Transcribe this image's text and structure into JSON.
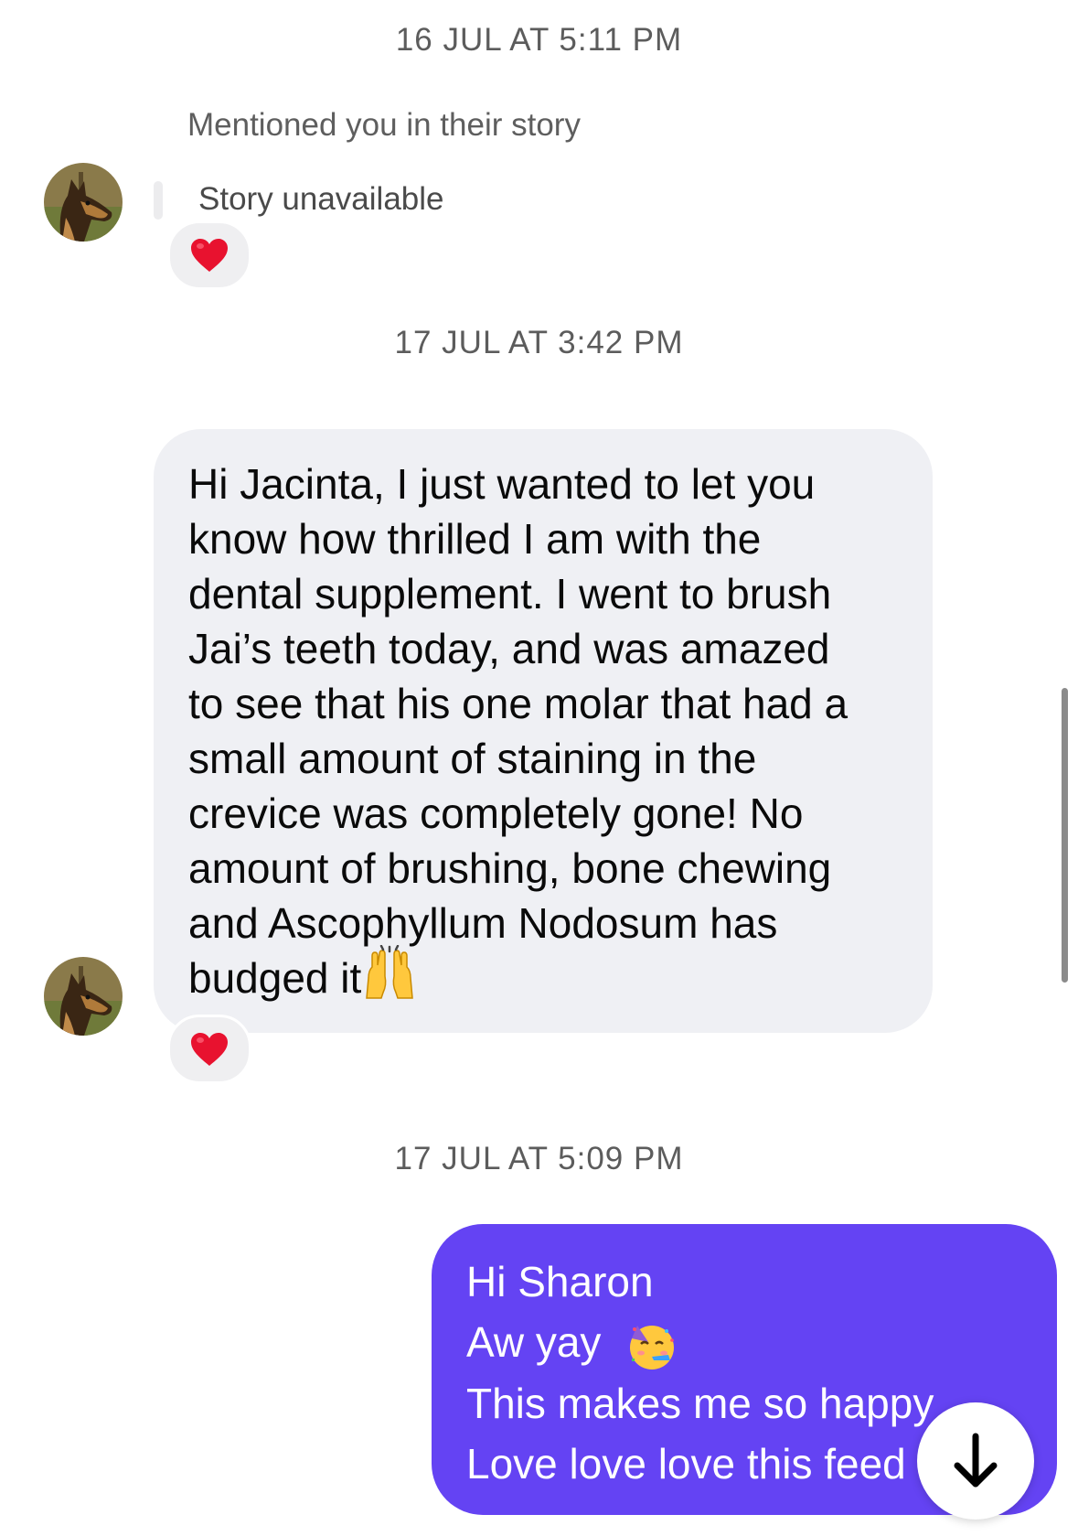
{
  "thread": {
    "timestamps": [
      "16 JUL AT 5:11 PM",
      "17 JUL AT 3:42 PM",
      "17 JUL AT 5:09 PM"
    ],
    "story": {
      "mention_text": "Mentioned you in their story",
      "status_text": "Story unavailable",
      "reaction": "red-heart"
    },
    "incoming_message": {
      "text": "Hi Jacinta, I just wanted to let you\nknow how thrilled I am with the\ndental supplement. I went to brush\nJai’s teeth today, and was amazed\nto see that his one molar that had a\nsmall amount of staining in the\ncrevice was completely gone! No\namount of brushing, bone chewing\nand Ascophyllum Nodosum has\nbudged it",
      "trailing_emoji": "raising-hands",
      "reaction": "red-heart"
    },
    "outgoing_message": {
      "lines": [
        "Hi Sharon",
        "Aw yay",
        "This makes me so happy",
        "Love love love this feed"
      ],
      "line2_emoji": "partying-face"
    }
  },
  "controls": {
    "scroll_down_icon": "arrow-down-icon"
  },
  "colors": {
    "outgoing_bubble": "#6443f3",
    "incoming_bubble": "#eff0f4",
    "timestamp_text": "#5c5c5c"
  }
}
